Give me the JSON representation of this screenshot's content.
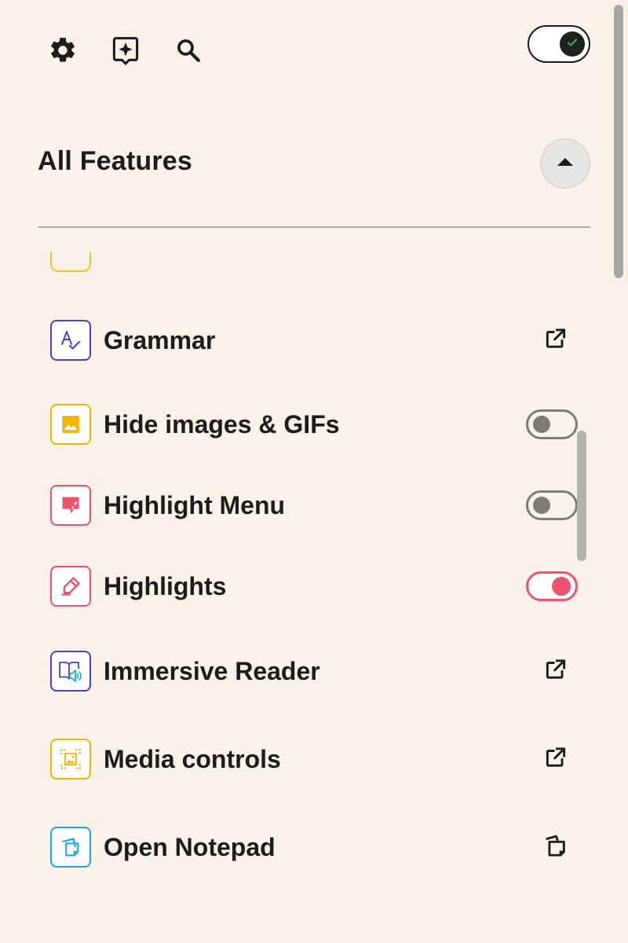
{
  "toolbar": {
    "settings_icon": "gear-icon",
    "ai_icon": "sparkle-bubble-icon",
    "search_icon": "search-icon",
    "master_toggle_on": true
  },
  "section": {
    "title": "All Features",
    "collapse_icon": "caret-up-icon"
  },
  "features": [
    {
      "label": "Grammar",
      "icon": "grammar-icon",
      "color": "#4b3fd0",
      "action": "external"
    },
    {
      "label": "Hide images & GIFs",
      "icon": "image-icon",
      "color": "#f2b705",
      "action": "toggle",
      "enabled": false
    },
    {
      "label": "Highlight Menu",
      "icon": "highlight-menu-icon",
      "color": "#f0516f",
      "action": "toggle",
      "enabled": false
    },
    {
      "label": "Highlights",
      "icon": "highlighter-icon",
      "color": "#f0516f",
      "action": "toggle",
      "enabled": true
    },
    {
      "label": "Immersive Reader",
      "icon": "immersive-reader-icon",
      "color": "#4b3fd0",
      "action": "external"
    },
    {
      "label": "Media controls",
      "icon": "media-controls-icon",
      "color": "#f2b705",
      "action": "external"
    },
    {
      "label": "Open Notepad",
      "icon": "notepad-icon",
      "color": "#1aa6e6",
      "action": "copy"
    }
  ],
  "colors": {
    "background": "#faf1e9",
    "text": "#1c1c1c",
    "toggle_on": "#f0516f",
    "toggle_off": "#7d7a77",
    "check_green": "#2bb24c"
  }
}
